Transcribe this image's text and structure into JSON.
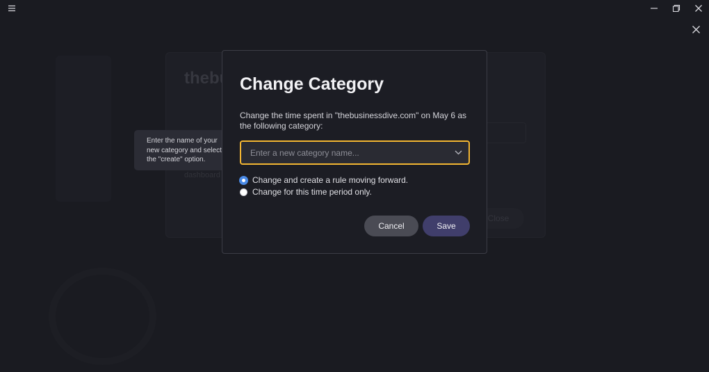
{
  "window": {
    "menu_icon": "hamburger-menu-icon",
    "minimize_icon": "minimize-icon",
    "restore_icon": "restore-icon",
    "close_icon": "close-icon"
  },
  "background": {
    "title": "thebu",
    "link": "dashboard",
    "close_label": "Close"
  },
  "tooltip": {
    "text": "Enter the name of your new category and select the \"create\" option."
  },
  "dialog": {
    "title": "Change Category",
    "description": "Change the time spent in \"thebusinessdive.com\" on May 6 as the following category:",
    "category_select": {
      "placeholder": "Enter a new category name...",
      "value": "",
      "focus_color": "#f3b632"
    },
    "options": [
      {
        "label": "Change and create a rule moving forward.",
        "selected": true
      },
      {
        "label": "Change for this time period only.",
        "selected": false
      }
    ],
    "cancel_label": "Cancel",
    "save_label": "Save"
  },
  "colors": {
    "background": "#1a1b21",
    "dialog": "#1c1d24",
    "accent_focus": "#f3b632",
    "radio_selected": "#4a8ae6",
    "save_button": "#403e6b",
    "cancel_button": "#4a4b54"
  }
}
